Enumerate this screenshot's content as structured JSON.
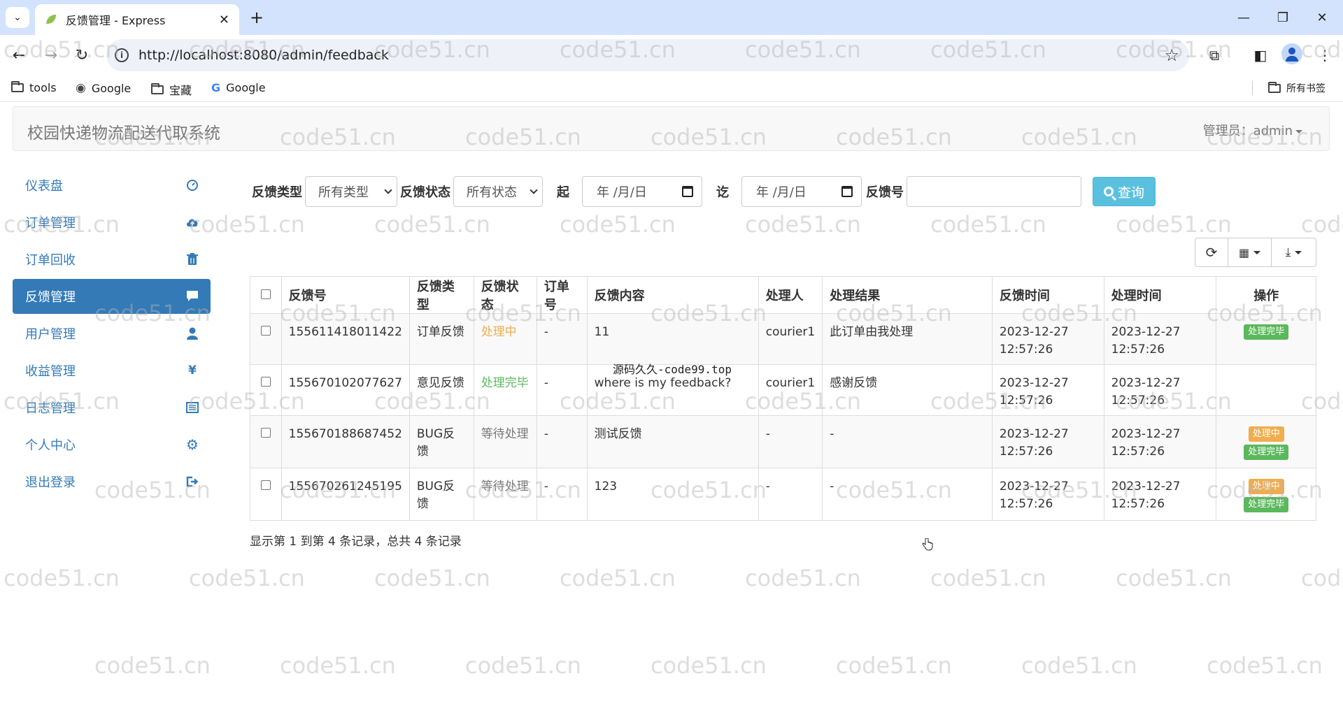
{
  "browser": {
    "tab_title": "反馈管理 - Express",
    "url": "http://localhost:8080/admin/feedback",
    "bookmarks": [
      "tools",
      "Google",
      "宝藏",
      "Google"
    ],
    "all_bookmarks": "所有书签"
  },
  "app": {
    "title": "校园快递物流配送代取系统",
    "admin_label": "管理员：admin"
  },
  "sidebar": {
    "items": [
      {
        "label": "仪表盘",
        "icon": "dashboard-icon"
      },
      {
        "label": "订单管理",
        "icon": "cloud-upload-icon"
      },
      {
        "label": "订单回收",
        "icon": "trash-icon"
      },
      {
        "label": "反馈管理",
        "icon": "comment-icon",
        "active": true
      },
      {
        "label": "用户管理",
        "icon": "user-icon"
      },
      {
        "label": "收益管理",
        "icon": "yen-icon"
      },
      {
        "label": "日志管理",
        "icon": "list-alt-icon"
      },
      {
        "label": "个人中心",
        "icon": "cog-icon"
      },
      {
        "label": "退出登录",
        "icon": "logout-icon"
      }
    ]
  },
  "filters": {
    "type_label": "反馈类型",
    "type_value": "所有类型",
    "status_label": "反馈状态",
    "status_value": "所有状态",
    "start_label": "起",
    "start_placeholder": "年 /月/日",
    "end_label": "讫",
    "end_placeholder": "年 /月/日",
    "id_label": "反馈号",
    "query_button": "查询"
  },
  "table": {
    "columns": [
      "反馈号",
      "反馈类型",
      "反馈状态",
      "订单号",
      "反馈内容",
      "处理人",
      "处理结果",
      "反馈时间",
      "处理时间",
      "操作"
    ],
    "rows": [
      {
        "id": "155611418011422",
        "type": "订单反馈",
        "status": "处理中",
        "status_color": "#f0ad4e",
        "order": "-",
        "content": "11",
        "handler": "courier1",
        "result": "此订单由我处理",
        "created": "2023-12-27 12:57:26",
        "handled": "2023-12-27 12:57:26",
        "actions": [
          "处理完毕"
        ]
      },
      {
        "id": "155670102077627",
        "type": "意见反馈",
        "status": "处理完毕",
        "status_color": "#5cb85c",
        "order": "-",
        "content": "where is my feedback?",
        "handler": "courier1",
        "result": "感谢反馈",
        "created": "2023-12-27 12:57:26",
        "handled": "2023-12-27 12:57:26",
        "actions": []
      },
      {
        "id": "155670188687452",
        "type": "BUG反馈",
        "status": "等待处理",
        "status_color": "#777777",
        "order": "-",
        "content": "测试反馈",
        "handler": "-",
        "result": "-",
        "created": "2023-12-27 12:57:26",
        "handled": "2023-12-27 12:57:26",
        "actions": [
          "处理中",
          "处理完毕"
        ]
      },
      {
        "id": "155670261245195",
        "type": "BUG反馈",
        "status": "等待处理",
        "status_color": "#777777",
        "order": "-",
        "content": "123",
        "handler": "-",
        "result": "-",
        "created": "2023-12-27 12:57:26",
        "handled": "2023-12-27 12:57:26",
        "actions": [
          "处理中",
          "处理完毕"
        ]
      }
    ]
  },
  "pagination_info": "显示第 1 到第 4 条记录，总共 4 条记录",
  "overlay_text": "源码久久-code99.top",
  "watermark": "code51.cn",
  "colors": {
    "primary": "#337ab7",
    "info": "#5bc0de",
    "success": "#5cb85c",
    "warning": "#f0ad4e"
  }
}
